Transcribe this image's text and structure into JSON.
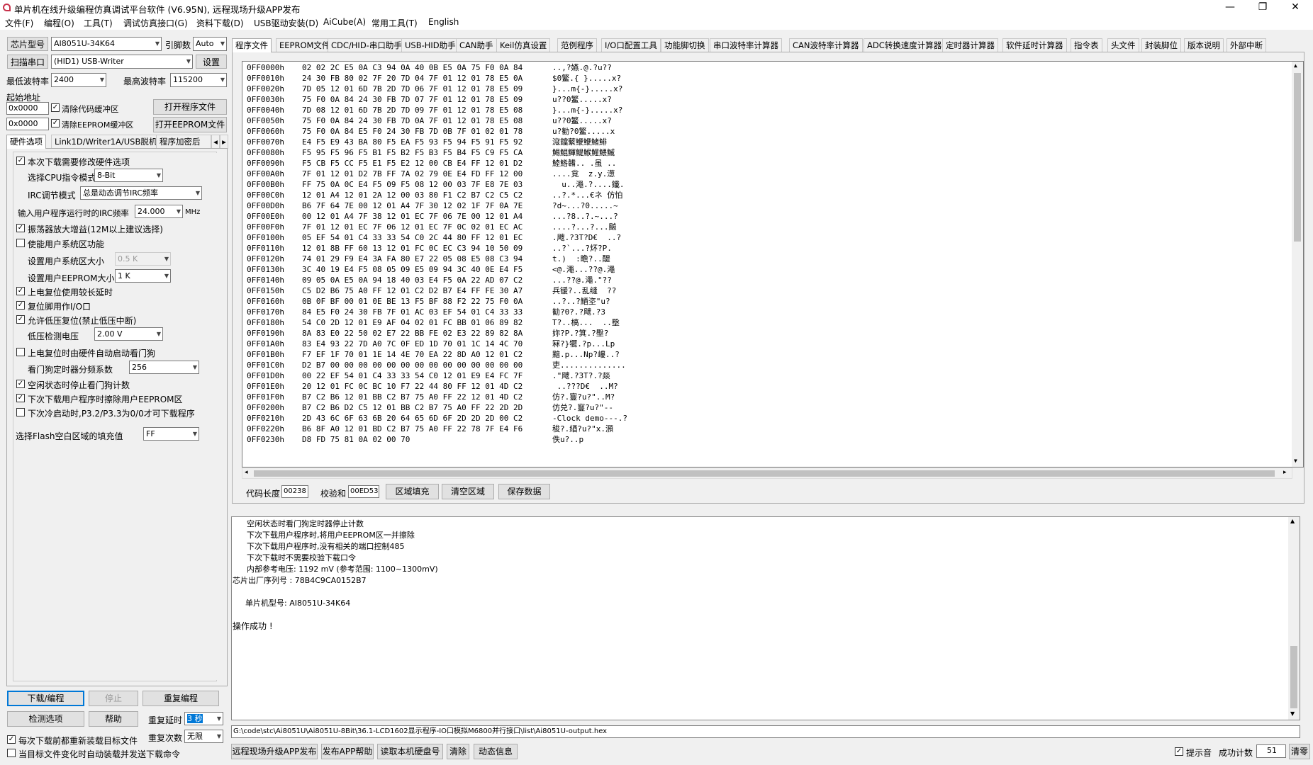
{
  "window": {
    "title": "单片机在线升级编程仿真调试平台软件 (V6.95N), 远程现场升级APP发布",
    "min": "—",
    "max": "❐",
    "close": "✕"
  },
  "menu": [
    "文件(F)",
    "编程(O)",
    "工具(T)",
    "调试仿真接口(G)",
    "资料下载(D)",
    "USB驱动安装(D)",
    "AiCube(A)",
    "常用工具(T)",
    "English"
  ],
  "left": {
    "chip_type_btn": "芯片型号",
    "chip_type": "AI8051U-34K64",
    "pin_label": "引脚数",
    "pin_value": "Auto",
    "scan_btn": "扫描串口",
    "port": "(HID1) USB-Writer",
    "settings_btn": "设置",
    "min_baud_label": "最低波特率",
    "min_baud": "2400",
    "max_baud_label": "最高波特率",
    "max_baud": "115200",
    "start_addr_label": "起始地址",
    "addr1": "0x0000",
    "clear_code": "清除代码缓冲区",
    "open_prog_btn": "打开程序文件",
    "addr2": "0x0000",
    "clear_eeprom": "清除EEPROM缓冲区",
    "open_eeprom_btn": "打开EEPROM文件",
    "tabs": [
      "硬件选项",
      "Link1D/Writer1A/USB脱机",
      "程序加密后"
    ],
    "opts": {
      "o1": "本次下载需要修改硬件选项",
      "cpu_label": "选择CPU指令模式",
      "cpu_val": "8-Bit",
      "irc_label": "IRC调节模式",
      "irc_val": "总是动态调节IRC频率",
      "freq_label": "输入用户程序运行时的IRC频率",
      "freq_val": "24.000",
      "freq_unit": "MHz",
      "o2": "振荡器放大增益(12M以上建议选择)",
      "o3": "使能用户系统区功能",
      "sys_label": "设置用户系统区大小",
      "sys_val": "0.5 K",
      "eep_label": "设置用户EEPROM大小",
      "eep_val": "1   K",
      "o4": "上电复位使用较长延时",
      "o5": "复位脚用作I/O口",
      "o6": "允许低压复位(禁止低压中断)",
      "lv_label": "低压检测电压",
      "lv_val": "2.00 V",
      "o7": "上电复位时由硬件自动启动看门狗",
      "wdt_label": "看门狗定时器分频系数",
      "wdt_val": "256",
      "o8": "空闲状态时停止看门狗计数",
      "o9": "下次下载用户程序时擦除用户EEPROM区",
      "o10": "下次冷启动时,P3.2/P3.3为0/0才可下载程序",
      "fill_label": "选择Flash空白区域的填充值",
      "fill_val": "FF"
    },
    "download_btn": "下载/编程",
    "stop_btn": "停止",
    "redo_btn": "重复编程",
    "check_btn": "检测选项",
    "help_btn": "帮助",
    "delay_label": "重复延时",
    "delay_val": "3 秒",
    "count_label": "重复次数",
    "count_val": "无限",
    "reload": "每次下载前都重新装载目标文件",
    "autosend": "当目标文件变化时自动装载并发送下载命令"
  },
  "right_tabs": [
    "程序文件",
    "EEPROM文件",
    "CDC/HID-串口助手",
    "USB-HID助手",
    "CAN助手",
    "Keil仿真设置",
    "范例程序",
    "I/O口配置工具",
    "功能脚切换",
    "串口波特率计算器",
    "CAN波特率计算器",
    "ADC转换速度计算器",
    "定时器计算器",
    "软件延时计算器",
    "指令表",
    "头文件",
    "封装脚位",
    "版本说明",
    "外部中断"
  ],
  "hex": {
    "rows": [
      [
        "0FF0000h",
        "02 02 2C E5 0A C3 94 0A 40 0B E5 0A 75 F0 0A 84",
        "..,?嬿.@.?u??"
      ],
      [
        "0FF0010h",
        "24 30 FB 80 02 7F 20 7D 04 7F 01 12 01 78 E5 0A",
        "$0鳘.{ }.....x?"
      ],
      [
        "0FF0020h",
        "7D 05 12 01 6D 7B 2D 7D 06 7F 01 12 01 78 E5 09",
        "}...m{-}.....x?"
      ],
      [
        "0FF0030h",
        "75 F0 0A 84 24 30 FB 7D 07 7F 01 12 01 78 E5 09",
        "u??0鳘.....x?"
      ],
      [
        "0FF0040h",
        "7D 08 12 01 6D 7B 2D 7D 09 7F 01 12 01 78 E5 08",
        "}...m{-}.....x?"
      ],
      [
        "0FF0050h",
        "75 F0 0A 84 24 30 FB 7D 0A 7F 01 12 01 78 E5 08",
        "u??0鳘.....x?"
      ],
      [
        "0FF0060h",
        "75 F0 0A 84 E5 F0 24 30 FB 7D 0B 7F 01 02 01 78",
        "u?勧?0鳘.....x"
      ],
      [
        "0FF0070h",
        "E4 F5 E9 43 BA 80 F5 EA F5 93 F5 94 F5 91 F5 92",
        "滱鐺蘩鯾鯾鯺鯡"
      ],
      [
        "0FF0080h",
        "F5 95 F5 96 F5 B1 F5 B2 F5 B3 F5 B4 F5 C9 F5 CA",
        "鯣鯤鯶鯷鯸鯹鰃鰄"
      ],
      [
        "0FF0090h",
        "F5 CB F5 CC F5 E1 F5 E2 12 00 CB E4 FF 12 01 D2",
        "鯥鯦韛.. .虽 .."
      ],
      [
        "0FF00A0h",
        "7F 01 12 01 D2 7B FF 7A 02 79 0E E4 FD FF 12 00",
        "....覍  z.y.濍"
      ],
      [
        "0FF00B0h",
        "FF 75 0A 0C E4 F5 09 F5 08 12 00 03 7F E8 7E 03",
        "  u..澠.?....鑯."
      ],
      [
        "0FF00C0h",
        "12 01 A4 12 01 2A 12 00 03 80 F1 C2 B7 C2 C5 C2",
        "..?.*...€ネ 仿怕"
      ],
      [
        "0FF00D0h",
        "B6 7F 64 7E 00 12 01 A4 7F 30 12 02 1F 7F 0A 7E",
        "?d~...?0.....~"
      ],
      [
        "0FF00E0h",
        "00 12 01 A4 7F 38 12 01 EC 7F 06 7E 00 12 01 A4",
        "...?8..?.~...?"
      ],
      [
        "0FF00F0h",
        "7F 01 12 01 EC 7F 06 12 01 EC 7F 0C 02 01 EC AC",
        "....?...?...飇"
      ],
      [
        "0FF0100h",
        "05 EF 54 01 C4 33 33 54 C0 2C 44 80 FF 12 01 EC",
        ".飕.?3T?D€  ..?"
      ],
      [
        "0FF0110h",
        "12 01 8B FF 60 13 12 01 FC 0C EC C3 94 10 50 09",
        "..?`...?炋?P."
      ],
      [
        "0FF0120h",
        "74 01 29 F9 E4 3A FA 80 E7 22 05 08 E5 08 C3 94",
        "t.)  :瞻?..醍"
      ],
      [
        "0FF0130h",
        "3C 40 19 E4 F5 08 05 09 E5 09 94 3C 40 0E E4 F5",
        "<@.澠...??@.澠"
      ],
      [
        "0FF0140h",
        "09 05 0A E5 0A 94 18 40 03 E4 F5 0A 22 AD 07 C2",
        "...??@.澠.\"??"
      ],
      [
        "0FF0150h",
        "C5 D2 B6 75 A0 FF 12 01 C2 D2 B7 E4 FF FE 30 A7",
        "兵锾?..乱缝  ??"
      ],
      [
        "0FF0160h",
        "0B 0F BF 00 01 0E BE 13 F5 BF 88 F2 22 75 F0 0A",
        "..?..?鯂垐\"u?"
      ],
      [
        "0FF0170h",
        "84 E5 F0 24 30 FB 7F 01 AC 03 EF 54 01 C4 33 33",
        "勧?0?.?飕.?3"
      ],
      [
        "0FF0180h",
        "54 C0 2D 12 01 E9 AF 04 02 01 FC BB 01 06 89 82",
        "T?..槁...  ..壂"
      ],
      [
        "0FF0190h",
        "8A 83 E0 22 50 02 E7 22 BB FE 02 E3 22 89 82 8A",
        "妳?P.?箕.?壂?"
      ],
      [
        "0FF01A0h",
        "83 E4 93 22 7D A0 7C 0F ED 1D 70 01 1C 14 4C 70",
        "冧?}犤.?p...Lp"
      ],
      [
        "0FF01B0h",
        "F7 EF 1F 70 01 1E 14 4E 70 EA 22 8D A0 12 01 C2",
        "黯.p...Np?嶁..?"
      ],
      [
        "0FF01C0h",
        "D2 B7 00 00 00 00 00 00 00 00 00 00 00 00 00 00",
        "吏.............."
      ],
      [
        "0FF01D0h",
        "00 22 EF 54 01 C4 33 33 54 C0 12 01 E9 E4 FC 7F",
        ".\"飕.?3T?.?燚"
      ],
      [
        "0FF01E0h",
        "20 12 01 FC 0C BC 10 F7 22 44 80 FF 12 01 4D C2",
        " ..???D€  ..M?"
      ],
      [
        "0FF01F0h",
        "B7 C2 B6 12 01 BB C2 B7 75 A0 FF 22 12 01 4D C2",
        "仿?.寷?u?\"..M?"
      ],
      [
        "0FF0200h",
        "B7 C2 B6 D2 C5 12 01 BB C2 B7 75 A0 FF 22 2D 2D",
        "仿兑?.寷?u?\"--"
      ],
      [
        "0FF0210h",
        "2D 43 6C 6F 63 6B 20 64 65 6D 6F 2D 2D 2D 00 C2",
        "-Clock demo---.?"
      ],
      [
        "0FF0220h",
        "B6 8F A0 12 01 BD C2 B7 75 A0 FF 22 78 7F E4 F6",
        "稄?.綇?u?\"x.澦"
      ],
      [
        "0FF0230h",
        "D8 FD 75 81 0A 02 00 70",
        "佚u?..p"
      ]
    ]
  },
  "bottom": {
    "code_len_label": "代码长度",
    "code_len": "00238",
    "checksum_label": "校验和",
    "checksum": "00ED53",
    "fill_btn": "区域填充",
    "clear_btn": "清空区域",
    "save_btn": "保存数据"
  },
  "log": [
    "  空闲状态时看门狗定时器停止计数",
    "  下次下载用户程序时,将用户EEPROM区一并擦除",
    "  下次下载用户程序时,没有相关的端口控制485",
    "  下次下载时不需要校验下载口令",
    "  内部参考电压: 1192 mV (参考范围: 1100~1300mV)",
    "芯片出厂序列号 : 78B4C9CA0152B7",
    "",
    "  单片机型号: AI8051U-34K64",
    "",
    "操作成功 !"
  ],
  "path": "G:\\code\\stc\\Ai8051U\\Ai8051U-8Bit\\36.1-LCD1602显示程序-IO口模拟M6800并行接口\\list\\Ai8051U-output.hex",
  "status": {
    "b1": "远程现场升级APP发布",
    "b2": "发布APP帮助",
    "b3": "读取本机硬盘号",
    "b4": "清除",
    "b5": "动态信息",
    "sound": "提示音",
    "success_label": "成功计数",
    "success": "51",
    "clear": "清零"
  }
}
